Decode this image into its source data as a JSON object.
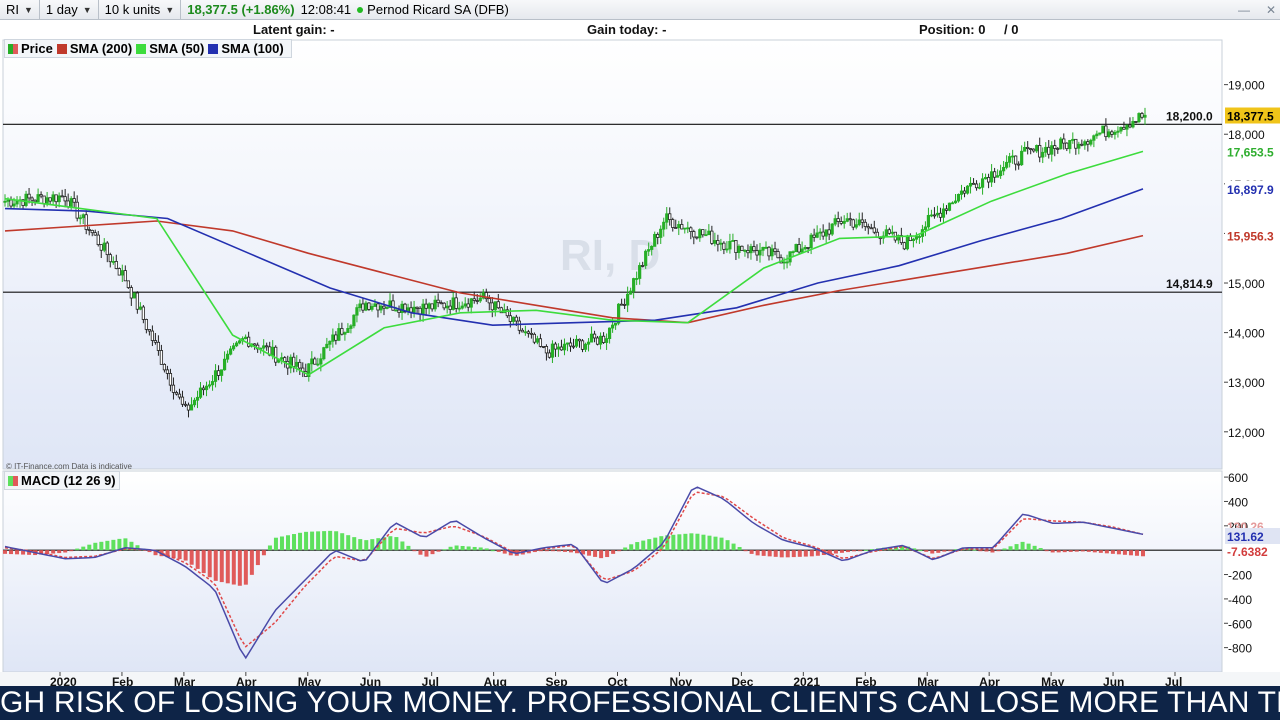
{
  "toolbar": {
    "symbol": "RI",
    "interval": "1 day",
    "units": "10 k units",
    "price_change": "18,377.5 (+1.86%)",
    "time": "12:08:41",
    "instrument": "Pernod Ricard SA (DFB)",
    "minimize_label": "—",
    "close_label": "✕"
  },
  "status": {
    "latent_gain": "Latent gain: -",
    "gain_today": "Gain today: -",
    "position": "Position: 0",
    "position_tail": "/ 0"
  },
  "legend": [
    "Price",
    "SMA (200)",
    "SMA (50)",
    "SMA (100)"
  ],
  "watermark": "RI, D",
  "source_note": "© IT-Finance.com  Data is indicative",
  "macd_label": "MACD (12 26 9)",
  "banner_text": "GH RISK OF LOSING YOUR MONEY. PROFESSIONAL CLIENTS CAN LOSE MORE THAN THEY DEPO",
  "colors": {
    "sma200": "#c0392b",
    "sma50": "#3ddc3d",
    "sma100": "#2330b0",
    "up": "#27ae27",
    "down": "#222222",
    "hist_pos": "#5ee05e",
    "hist_neg": "#e05a5a",
    "macd_line": "#4a4aa8",
    "signal_line": "#e04848",
    "last_price_bg": "#f0c419"
  },
  "chart_data": [
    {
      "type": "candlestick",
      "title": "Pernod Ricard SA (DFB)",
      "x_ticks": [
        "2020",
        "Feb",
        "Mar",
        "Apr",
        "May",
        "Jun",
        "Jul",
        "Aug",
        "Sep",
        "Oct",
        "Nov",
        "Dec",
        "2021",
        "Feb",
        "Mar",
        "Apr",
        "May",
        "Jun",
        "Jul"
      ],
      "y_ticks": [
        12000,
        13000,
        14000,
        15000,
        16000,
        17000,
        18000,
        19000
      ],
      "y_tick_labels": [
        "12,000",
        "13,000",
        "14,000",
        "15,000",
        "16,000",
        "17,000",
        "18,000",
        "19,000"
      ],
      "ylim": [
        11250,
        19900
      ],
      "last_price": 18377.5,
      "last_price_label": "18,377.5",
      "horizontal_lines": [
        {
          "value": 18200.0,
          "label": "18,200.0"
        },
        {
          "value": 14814.9,
          "label": "14,814.9"
        }
      ],
      "series": [
        {
          "name": "Price",
          "month_closes": [
            16650,
            16750,
            15100,
            12400,
            13900,
            13200,
            14600,
            14500,
            14700,
            13600,
            13900,
            16300,
            15800,
            15500,
            16300,
            15800,
            16900,
            17600,
            17900,
            18377.5
          ]
        },
        {
          "name": "SMA (200)",
          "value_label": "15,956.3",
          "points": [
            16050,
            16150,
            16250,
            16050,
            15600,
            15200,
            14800,
            14550,
            14300,
            14200,
            14550,
            14850,
            15100,
            15350,
            15600,
            15956.3
          ]
        },
        {
          "name": "SMA (50)",
          "value_label": "17,653.5",
          "points": [
            16700,
            16500,
            16300,
            13950,
            13150,
            14100,
            14400,
            14450,
            14250,
            14200,
            15300,
            15900,
            15950,
            16650,
            17200,
            17653.5
          ]
        },
        {
          "name": "SMA (100)",
          "value_label": "16,897.9",
          "points": [
            16500,
            16450,
            16300,
            15600,
            14900,
            14400,
            14150,
            14200,
            14250,
            14500,
            15000,
            15350,
            15850,
            16300,
            16897.9
          ]
        }
      ]
    },
    {
      "type": "line",
      "title": "MACD (12 26 9)",
      "y_ticks": [
        -800,
        -600,
        -400,
        -200,
        0,
        200,
        400,
        600
      ],
      "y_tick_labels": [
        "-800",
        "-600",
        "-400",
        "-200",
        "",
        "200",
        "400",
        "600"
      ],
      "ylim": [
        -1000,
        650
      ],
      "value_labels": [
        "130.26",
        "131.62",
        "-7.6382"
      ],
      "series": [
        {
          "name": "MACD",
          "values": [
            30,
            -20,
            -70,
            -60,
            20,
            0,
            -130,
            -320,
            -900,
            -500,
            -250,
            0,
            -100,
            230,
            100,
            250,
            100,
            -30,
            20,
            50,
            -280,
            -150,
            60,
            530,
            420,
            220,
            80,
            20,
            -90,
            0,
            40,
            -80,
            20,
            20,
            300,
            220,
            230,
            180,
            130
          ]
        },
        {
          "name": "Signal",
          "values": [
            20,
            -10,
            -60,
            -50,
            10,
            0,
            -100,
            -270,
            -800,
            -600,
            -300,
            -50,
            -90,
            180,
            140,
            200,
            110,
            -20,
            10,
            40,
            -250,
            -170,
            20,
            480,
            440,
            260,
            100,
            30,
            -70,
            -10,
            30,
            -70,
            10,
            10,
            260,
            240,
            230,
            190,
            130
          ]
        },
        {
          "name": "Histogram",
          "values": [
            -30,
            -40,
            -20,
            60,
            100,
            -40,
            -80,
            -250,
            -300,
            100,
            150,
            160,
            80,
            120,
            -60,
            40,
            20,
            -50,
            0,
            -20,
            -70,
            60,
            120,
            140,
            100,
            -40,
            -60,
            -50,
            -20,
            10,
            40,
            -30,
            20,
            -20,
            70,
            -20,
            -10,
            -30,
            -50
          ]
        }
      ]
    }
  ]
}
